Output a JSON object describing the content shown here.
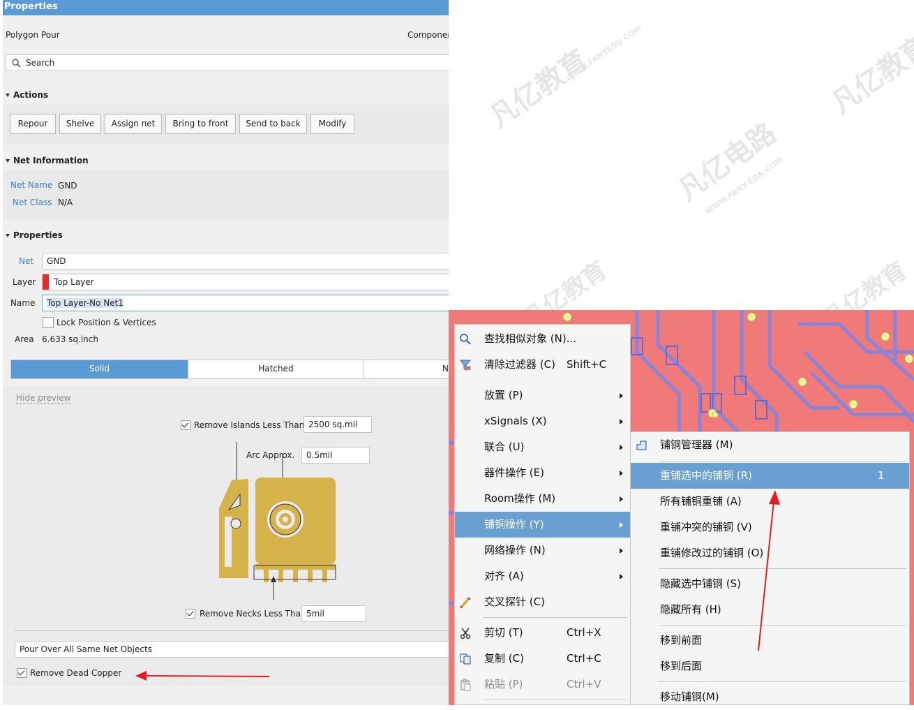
{
  "panel": {
    "title": "Properties",
    "object_type": "Polygon Pour",
    "component_tab": "Componer",
    "search_placeholder": "Search"
  },
  "actions": {
    "heading": "Actions",
    "buttons": [
      "Repour",
      "Shelve",
      "Assign net",
      "Bring to front",
      "Send to back",
      "Modify"
    ]
  },
  "net_info": {
    "heading": "Net Information",
    "net_name_label": "Net Name",
    "net_name_value": "GND",
    "net_class_label": "Net Class",
    "net_class_value": "N/A"
  },
  "properties": {
    "heading": "Properties",
    "net_label": "Net",
    "net_value": "GND",
    "layer_label": "Layer",
    "layer_value": "Top Layer",
    "layer_color": "#e52b2b",
    "name_label": "Name",
    "name_value": "Top Layer-No Net1",
    "lock_label": "Lock Position & Vertices",
    "area_label": "Area",
    "area_value": "6.633 sq.inch"
  },
  "fill_modes": {
    "solid": "Solid",
    "hatched": "Hatched",
    "none": "N"
  },
  "preview": {
    "hide_link": "Hide preview",
    "remove_islands_label": "Remove Islands Less Than",
    "remove_islands_value": "2500 sq.mil",
    "arc_label": "Arc Approx.",
    "arc_value": "0.5mil",
    "remove_necks_label": "Remove Necks Less Than",
    "remove_necks_value": "5mil"
  },
  "pour_mode_value": "Pour Over All Same Net Objects",
  "remove_dead_copper_label": "Remove Dead Copper",
  "context_menu": {
    "items": [
      {
        "label": "查找相似对象 (N)...",
        "shortcut": ""
      },
      {
        "label": "清除过滤器 (C)",
        "shortcut": "Shift+C"
      },
      {
        "label": "放置 (P)",
        "shortcut": ""
      },
      {
        "label": "xSignals (X)",
        "shortcut": ""
      },
      {
        "label": "联合 (U)",
        "shortcut": ""
      },
      {
        "label": "器件操作 (E)",
        "shortcut": ""
      },
      {
        "label": "Room操作 (M)",
        "shortcut": ""
      },
      {
        "label": "铺铜操作 (Y)",
        "shortcut": ""
      },
      {
        "label": "网络操作 (N)",
        "shortcut": ""
      },
      {
        "label": "对齐 (A)",
        "shortcut": ""
      },
      {
        "label": "交叉探针 (C)",
        "shortcut": ""
      },
      {
        "label": "剪切 (T)",
        "shortcut": "Ctrl+X"
      },
      {
        "label": "复制 (C)",
        "shortcut": "Ctrl+C"
      },
      {
        "label": "粘贴 (P)",
        "shortcut": "Ctrl+V"
      }
    ]
  },
  "sub_menu": {
    "items": [
      {
        "label": "铺铜管理器 (M)",
        "badge": ""
      },
      {
        "label": "重铺选中的铺铜 (R)",
        "badge": "1"
      },
      {
        "label": "所有铺铜重铺 (A)",
        "badge": ""
      },
      {
        "label": "重铺冲突的铺铜 (V)",
        "badge": ""
      },
      {
        "label": "重铺修改过的铺铜 (O)",
        "badge": ""
      },
      {
        "label": "隐藏选中铺铜 (S)",
        "badge": ""
      },
      {
        "label": "隐藏所有 (H)",
        "badge": ""
      },
      {
        "label": "移到前面",
        "badge": ""
      },
      {
        "label": "移到后面",
        "badge": ""
      },
      {
        "label": "移动铺铜(M)",
        "badge": ""
      }
    ]
  },
  "colors": {
    "accent": "#5b9bd5",
    "menu_highlight": "#6a9fd1",
    "annotation_red": "#e81c1c",
    "pcb_copper": "#f0797a",
    "pcb_trace": "#8a84d8",
    "preview_copper": "#d6b24a"
  },
  "icons": {
    "search": "magnifier-icon",
    "clear_filter": "funnel-clear-icon",
    "cross_probe": "pen-probe-icon",
    "cut": "scissors-icon",
    "copy": "copy-icon",
    "paste": "paste-icon",
    "polygon_manager": "polygon-manager-icon"
  },
  "watermarks": [
    "凡亿教育",
    "WWW.FANYEDU.COM",
    "凡亿电路",
    "WWW.FANY-EDA.COM"
  ]
}
